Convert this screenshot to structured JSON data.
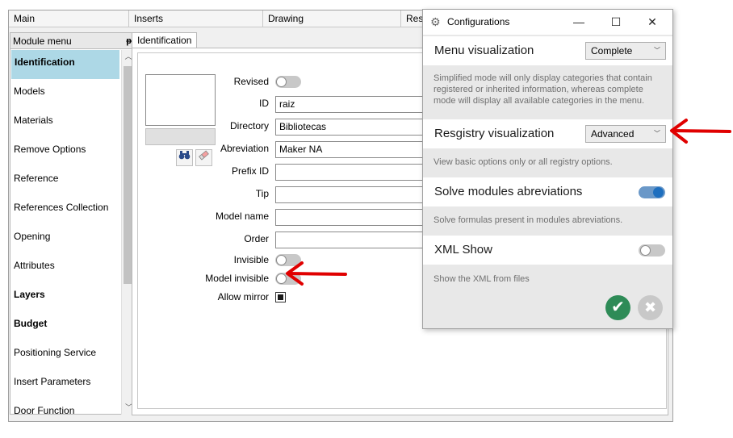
{
  "menubar": {
    "tabs": [
      "Main",
      "Inserts",
      "Drawing",
      "Res"
    ]
  },
  "sidebar": {
    "title": "Module menu",
    "pin_glyph": "pin-icon",
    "items": [
      {
        "label": "Identification",
        "bold": true,
        "selected": true
      },
      {
        "label": "Models",
        "bold": false,
        "selected": false
      },
      {
        "label": "Materials",
        "bold": false,
        "selected": false
      },
      {
        "label": "Remove Options",
        "bold": false,
        "selected": false
      },
      {
        "label": "Reference",
        "bold": false,
        "selected": false
      },
      {
        "label": "References Collection",
        "bold": false,
        "selected": false
      },
      {
        "label": "Opening",
        "bold": false,
        "selected": false
      },
      {
        "label": "Attributes",
        "bold": false,
        "selected": false
      },
      {
        "label": "Layers",
        "bold": true,
        "selected": false
      },
      {
        "label": "Budget",
        "bold": true,
        "selected": false
      },
      {
        "label": "Positioning Service",
        "bold": false,
        "selected": false
      },
      {
        "label": "Insert Parameters",
        "bold": false,
        "selected": false
      },
      {
        "label": "Door Function",
        "bold": false,
        "selected": false
      }
    ]
  },
  "content": {
    "tab_label": "Identification",
    "form": {
      "revised_label": "Revised",
      "id_label": "ID",
      "id_value": "raiz",
      "directory_label": "Directory",
      "directory_value": "Bibliotecas",
      "abreviation_label": "Abreviation",
      "abreviation_value": "Maker NA",
      "prefix_label": "Prefix ID",
      "prefix_value": "",
      "tip_label": "Tip",
      "tip_value": "",
      "model_name_label": "Model name",
      "model_name_value": "",
      "order_label": "Order",
      "order_value": "",
      "invisible_label": "Invisible",
      "model_invisible_label": "Model invisible",
      "allow_mirror_label": "Allow mirror",
      "allow_mirror_checked": true,
      "revised_on": false,
      "invisible_on": false,
      "model_invisible_on": false
    }
  },
  "dialog": {
    "title": "Configurations",
    "menu_visualization": {
      "label": "Menu visualization",
      "value": "Complete",
      "description": "Simplified mode will only display categories that contain registered or inherited information, whereas complete mode will display all available categories in the menu."
    },
    "registry_visualization": {
      "label": "Resgistry visualization",
      "value": "Advanced",
      "description": "View basic options only or all registry options."
    },
    "solve_modules": {
      "label": "Solve modules abreviations",
      "on": true,
      "description": "Solve formulas present in modules abreviations."
    },
    "xml_show": {
      "label": "XML Show",
      "on": false,
      "description": "Show the XML from files"
    }
  },
  "colors": {
    "selected_item": "#add8e6",
    "toggle_on": "#1e6fbf",
    "ok_button": "#2e8b57",
    "annotation_arrow": "#e00000"
  }
}
